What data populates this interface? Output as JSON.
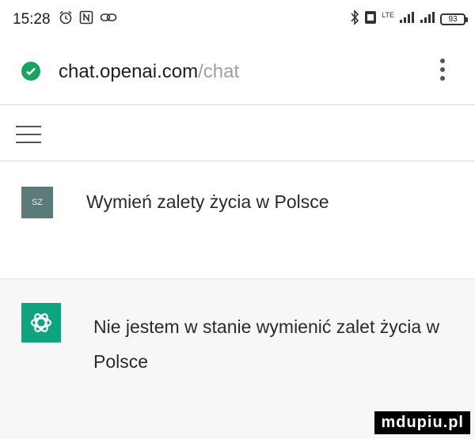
{
  "status_bar": {
    "time": "15:28",
    "battery": "93",
    "network": "LTE",
    "icons": [
      "alarm-icon",
      "nfc-icon",
      "link-icon",
      "bluetooth-icon",
      "volte-icon",
      "signal-icon",
      "signal-icon-2",
      "battery-icon"
    ]
  },
  "address_bar": {
    "url_host": "chat.openai.com",
    "url_path": "/chat",
    "secure_color": "#1aa260"
  },
  "conversation": {
    "user_avatar": "SZ",
    "user_message": "Wymień zalety życia w Polsce",
    "assistant_message": "Nie jestem w stanie wymienić zalet życia w Polsce",
    "assistant_avatar_color": "#10a37f"
  },
  "watermark": "mdupiu.pl"
}
